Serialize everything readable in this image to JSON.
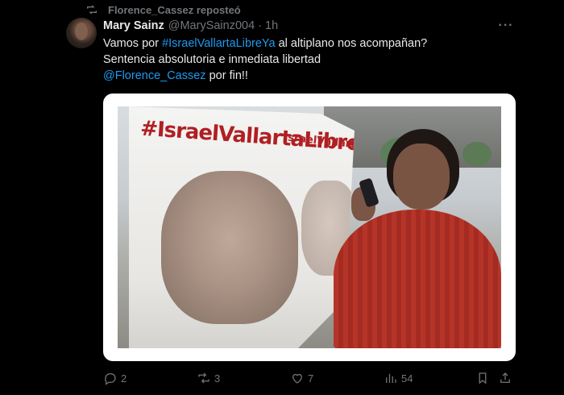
{
  "repost": {
    "icon": "repost-icon",
    "label": "Florence_Cassez reposteó"
  },
  "tweet": {
    "author_name": "Mary Sainz",
    "author_handle": "@MarySainz004",
    "separator": "·",
    "time": "1h",
    "more_icon": "more-options-icon",
    "text": {
      "line1_before": "Vamos por ",
      "hashtag": "#IsraelVallartaLibreYa",
      "line1_after": " al altiplano nos acompañan?",
      "line2": "Sentencia absolutoria e inmediata libertad",
      "mention": "@Florence_Cassez",
      "line3_after": " por fin!!"
    },
    "media": {
      "banner_text_main": "#IsraelVallartaLibre",
      "banner_text_sub": "IsraelVallartaLibre"
    }
  },
  "actions": {
    "reply": {
      "icon": "reply-icon",
      "count": "2"
    },
    "repost": {
      "icon": "repost-icon",
      "count": "3"
    },
    "like": {
      "icon": "heart-icon",
      "count": "7"
    },
    "views": {
      "icon": "views-icon",
      "count": "54"
    },
    "bookmark": {
      "icon": "bookmark-icon"
    },
    "share": {
      "icon": "share-icon"
    }
  },
  "colors": {
    "background": "#000000",
    "text": "#e7e9ea",
    "muted": "#71767b",
    "link": "#1d9bf0",
    "banner_red": "#b01f23",
    "sweater": "#b53428"
  }
}
